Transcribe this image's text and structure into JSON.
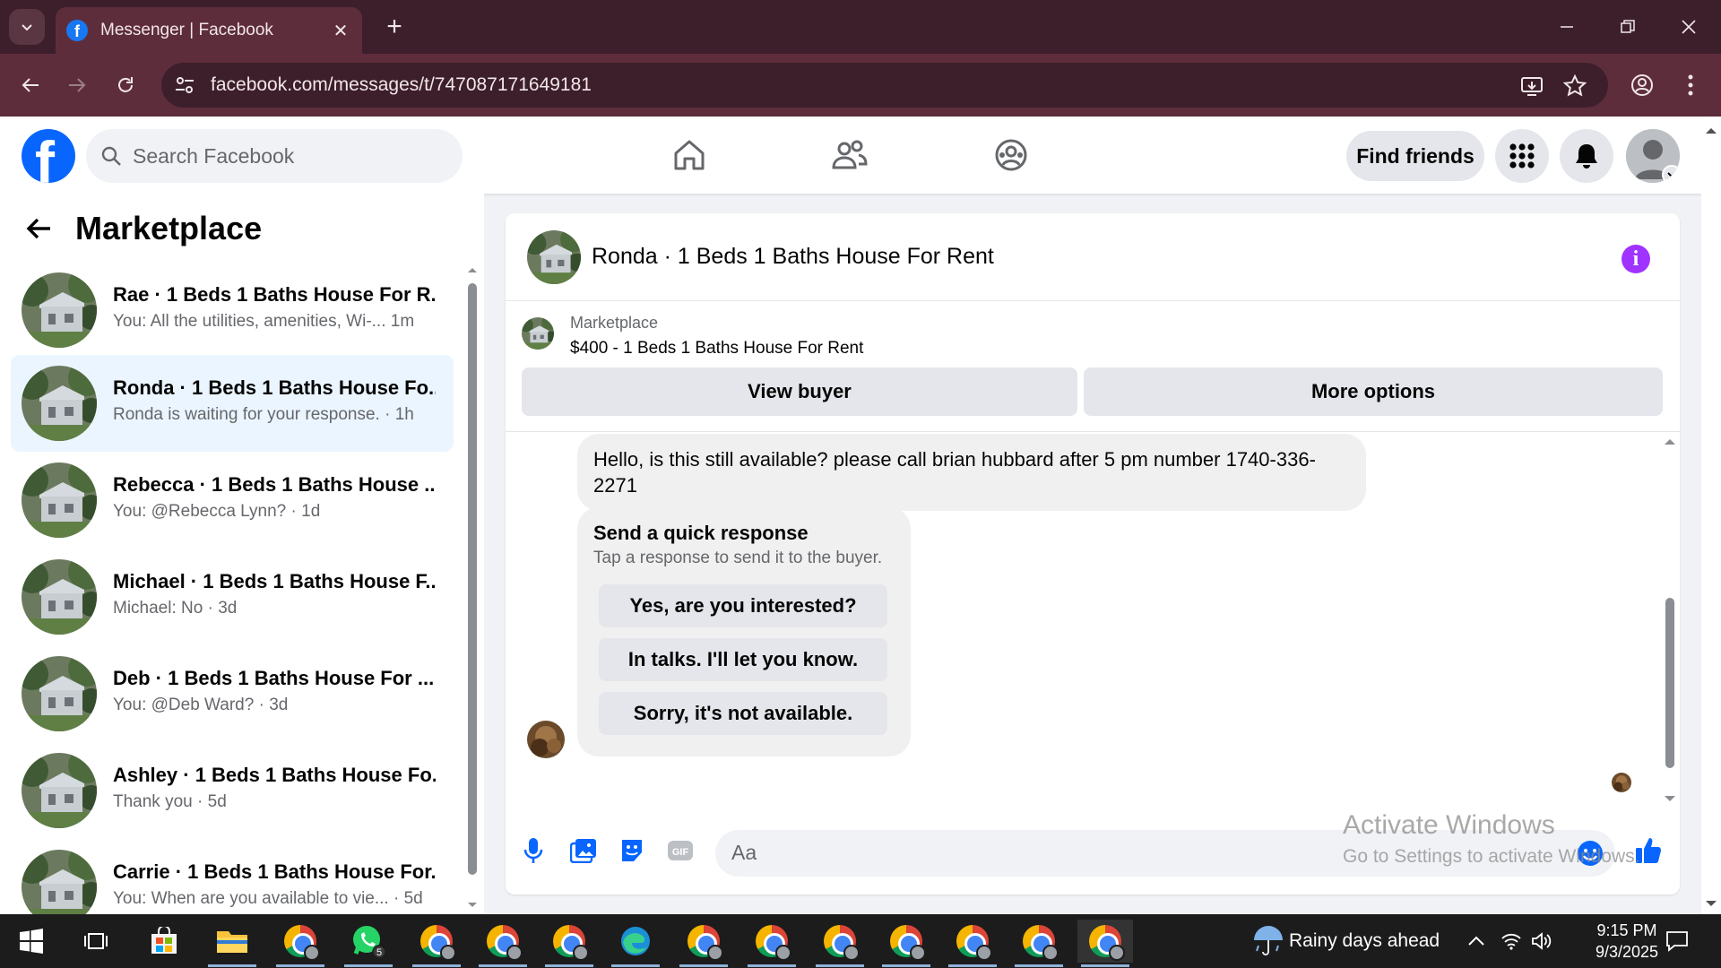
{
  "browser": {
    "tab_title": "Messenger | Facebook",
    "url": "facebook.com/messages/t/747087171649181"
  },
  "header": {
    "search_placeholder": "Search Facebook",
    "find_friends": "Find friends"
  },
  "sidebar": {
    "title": "Marketplace",
    "conversations": [
      {
        "name": "Rae · 1 Beds 1 Baths House For R...",
        "preview": "You: All the utilities, amenities, Wi-...",
        "time": "1m",
        "active": false
      },
      {
        "name": "Ronda · 1 Beds 1 Baths House Fo...",
        "preview": "Ronda is waiting for your response.",
        "time": "1h",
        "active": true
      },
      {
        "name": "Rebecca · 1 Beds 1 Baths House ...",
        "preview": "You: @Rebecca Lynn?",
        "time": "1d",
        "active": false
      },
      {
        "name": "Michael · 1 Beds 1 Baths House F...",
        "preview": "Michael: No",
        "time": "3d",
        "active": false
      },
      {
        "name": "Deb · 1 Beds 1 Baths House For ...",
        "preview": "You: @Deb Ward?",
        "time": "3d",
        "active": false
      },
      {
        "name": "Ashley · 1 Beds 1 Baths House Fo...",
        "preview": "Thank you",
        "time": "5d",
        "active": false
      },
      {
        "name": "Carrie · 1 Beds 1 Baths House For...",
        "preview": "You: When are you available to vie...",
        "time": "5d",
        "active": false
      }
    ]
  },
  "chat": {
    "title": "Ronda · 1 Beds 1 Baths House For Rent",
    "listing_label": "Marketplace",
    "listing_price": "$400 - 1 Beds 1 Baths House For Rent",
    "view_buyer": "View buyer",
    "more_options": "More options",
    "message": "Hello, is this still available? please call brian hubbard after 5 pm  number 1740-336-2271",
    "quick_response": {
      "heading": "Send a quick response",
      "subtext": "Tap a response to send it to the buyer.",
      "options": [
        "Yes, are you interested?",
        "In talks. I'll let you know.",
        "Sorry, it's not available."
      ]
    },
    "composer_placeholder": "Aa"
  },
  "watermark": {
    "line1": "Activate Windows",
    "line2": "Go to Settings to activate Windows."
  },
  "taskbar": {
    "weather": "Rainy days ahead",
    "time": "9:15 PM",
    "date": "9/3/2025",
    "whatsapp_badge": "5"
  },
  "colors": {
    "chrome_frame": "#3c1f2a",
    "chrome_toolbar": "#5e2d3c",
    "facebook_blue": "#0866ff",
    "active_conversation": "#ebf5ff",
    "info_purple": "#a033ff"
  }
}
